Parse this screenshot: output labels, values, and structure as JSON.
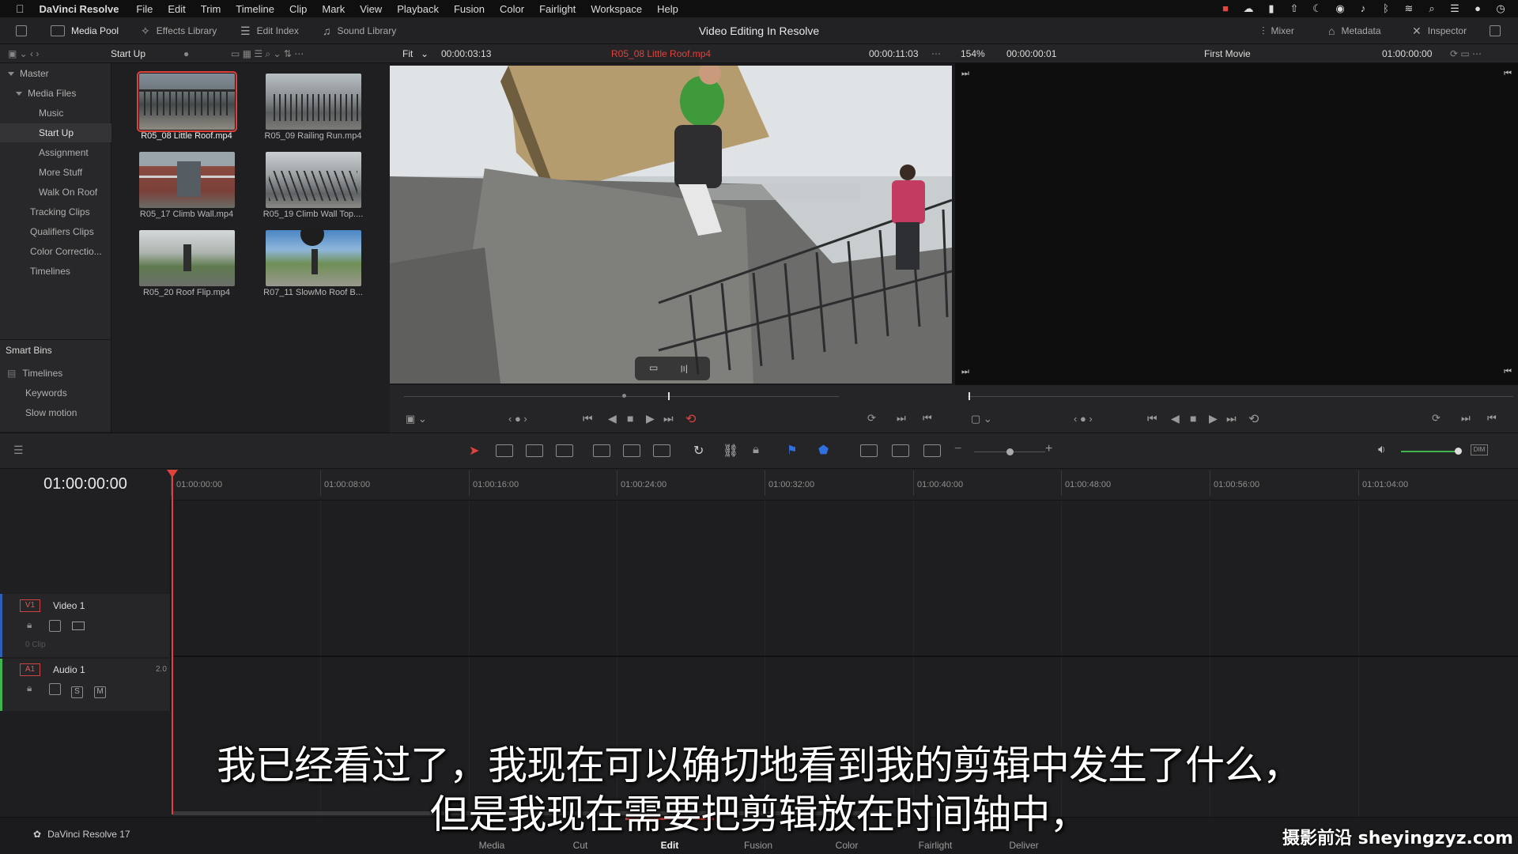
{
  "menubar": {
    "app_name": "DaVinci Resolve",
    "items": [
      "File",
      "Edit",
      "Trim",
      "Timeline",
      "Clip",
      "Mark",
      "View",
      "Playback",
      "Fusion",
      "Color",
      "Fairlight",
      "Workspace",
      "Help"
    ]
  },
  "toolbar": {
    "media_pool": "Media Pool",
    "effects_library": "Effects Library",
    "edit_index": "Edit Index",
    "sound_library": "Sound Library",
    "window_title": "Video Editing In Resolve",
    "mixer": "Mixer",
    "metadata": "Metadata",
    "inspector": "Inspector"
  },
  "subbar": {
    "bin_name": "Start Up",
    "fit": "Fit",
    "source_timecode": "00:00:03:13",
    "clip_name": "R05_08 Little Roof.mp4",
    "clip_duration": "00:00:11:03",
    "zoom": "154%",
    "program_timecode": "00:00:00:01",
    "timeline_name": "First Movie",
    "timeline_timecode": "01:00:00:00"
  },
  "sidebar": {
    "master": "Master",
    "media_files": "Media Files",
    "bins": [
      "Music",
      "Start Up",
      "Assignment",
      "More Stuff",
      "Walk On Roof"
    ],
    "top_bins": [
      "Tracking Clips",
      "Qualifiers Clips",
      "Color Correctio...",
      "Timelines"
    ],
    "smart_bins_title": "Smart Bins",
    "smart_bins": [
      "Timelines",
      "Keywords",
      "Slow motion"
    ]
  },
  "clips": [
    {
      "name": "R05_08 Little Roof.mp4",
      "selected": true
    },
    {
      "name": "R05_09 Railing Run.mp4",
      "selected": false
    },
    {
      "name": "R05_17 Climb Wall.mp4",
      "selected": false
    },
    {
      "name": "R05_19 Climb Wall Top....",
      "selected": false
    },
    {
      "name": "R05_20 Roof Flip.mp4",
      "selected": false
    },
    {
      "name": "R07_11 SlowMo Roof B...",
      "selected": false
    }
  ],
  "timeline": {
    "current_timecode": "01:00:00:00",
    "ruler": [
      "01:00:00:00",
      "01:00:08:00",
      "01:00:16:00",
      "01:00:24:00",
      "01:00:32:00",
      "01:00:40:00",
      "01:00:48:00",
      "01:00:56:00",
      "01:01:04:00"
    ],
    "video_track": {
      "id": "V1",
      "name": "Video 1",
      "clips": "0 Clip"
    },
    "audio_track": {
      "id": "A1",
      "name": "Audio 1",
      "channels": "2.0",
      "solo": "S",
      "mute": "M"
    }
  },
  "pages": [
    "Media",
    "Cut",
    "Edit",
    "Fusion",
    "Color",
    "Fairlight",
    "Deliver"
  ],
  "active_page": "Edit",
  "project_label": "DaVinci Resolve 17",
  "subtitle": {
    "line1": "我已经看过了，我现在可以确切地看到我的剪辑中发生了什么，",
    "line2": "但是我现在需要把剪辑放在时间轴中，"
  },
  "watermark": "摄影前沿 sheyingzyz.com",
  "colors": {
    "accent_red": "#e1423c",
    "audio_green": "#3fb54f",
    "flag_blue": "#2f6fe0"
  }
}
